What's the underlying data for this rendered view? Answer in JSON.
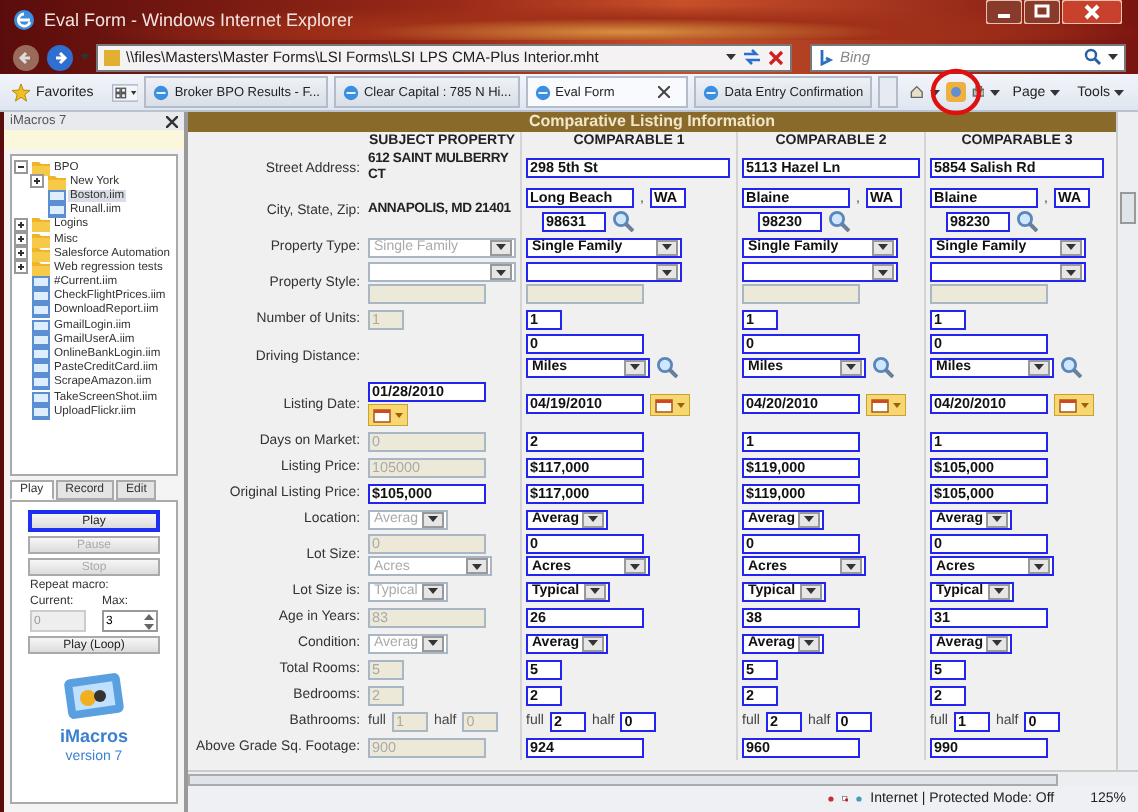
{
  "window": {
    "title": "Eval Form - Windows Internet Explorer"
  },
  "address_bar": {
    "url": "\\\\files\\Masters\\Master Forms\\LSI Forms\\LSI LPS CMA-Plus Interior.mht"
  },
  "search": {
    "placeholder": "Bing"
  },
  "favorites_bar": {
    "favorites_label": "Favorites",
    "tabs": [
      {
        "title": "Broker BPO Results - F...",
        "selected": false
      },
      {
        "title": "Clear Capital : 785 N Hi...",
        "selected": false
      },
      {
        "title": "Eval Form",
        "selected": true
      },
      {
        "title": "Data Entry Confirmation",
        "selected": false
      }
    ],
    "menus": [
      "Page",
      "Tools"
    ]
  },
  "sidebar": {
    "title": "iMacros 7",
    "tree": [
      {
        "label": "BPO",
        "kind": "folder",
        "expanded": true,
        "selected": false,
        "children": [
          {
            "label": "New York",
            "kind": "folder",
            "expanded": false,
            "selected": false
          },
          {
            "label": "Boston.iim",
            "kind": "file",
            "selected": true
          },
          {
            "label": "Runall.iim",
            "kind": "file",
            "selected": false
          }
        ]
      },
      {
        "label": "Logins",
        "kind": "folder",
        "expanded": false,
        "selected": false
      },
      {
        "label": "Misc",
        "kind": "folder",
        "expanded": false,
        "selected": false
      },
      {
        "label": "Salesforce Automation",
        "kind": "folder",
        "expanded": false,
        "selected": false
      },
      {
        "label": "Web regression tests",
        "kind": "folder",
        "expanded": false,
        "selected": false
      },
      {
        "label": "#Current.iim",
        "kind": "file",
        "selected": false
      },
      {
        "label": "CheckFlightPrices.iim",
        "kind": "file",
        "selected": false
      },
      {
        "label": "DownloadReport.iim",
        "kind": "file",
        "selected": false
      },
      {
        "label": "GmailLogin.iim",
        "kind": "file",
        "selected": false
      },
      {
        "label": "GmailUserA.iim",
        "kind": "file",
        "selected": false
      },
      {
        "label": "OnlineBankLogin.iim",
        "kind": "file",
        "selected": false
      },
      {
        "label": "PasteCreditCard.iim",
        "kind": "file",
        "selected": false
      },
      {
        "label": "ScrapeAmazon.iim",
        "kind": "file",
        "selected": false
      },
      {
        "label": "TakeScreenShot.iim",
        "kind": "file",
        "selected": false
      },
      {
        "label": "UploadFlickr.iim",
        "kind": "file",
        "selected": false
      }
    ],
    "tabs": [
      {
        "label": "Play",
        "selected": true
      },
      {
        "label": "Record",
        "selected": false
      },
      {
        "label": "Edit",
        "selected": false
      }
    ],
    "buttons": [
      {
        "label": "Play",
        "disabled": false,
        "focused": true
      },
      {
        "label": "Pause",
        "disabled": true,
        "focused": false
      },
      {
        "label": "Stop",
        "disabled": true,
        "focused": false
      }
    ],
    "repeat": {
      "label": "Repeat macro:",
      "current_label": "Current:",
      "max_label": "Max:",
      "current_value": "0",
      "max_value": "3"
    },
    "loop_button": "Play (Loop)",
    "logo": {
      "name": "iMacros",
      "version": "version 7"
    }
  },
  "form": {
    "banner": "Comparative Listing Information",
    "columns": [
      "SUBJECT PROPERTY",
      "COMPARABLE 1",
      "COMPARABLE 2",
      "COMPARABLE 3"
    ],
    "rows": [
      {
        "label": "Street Address:",
        "cells": [
          [
            {
              "kind": "text",
              "value": "612 SAINT MULBERRY CT"
            }
          ],
          [
            {
              "kind": "wide-input",
              "value": "298 5th St",
              "disabled": false
            }
          ],
          [
            {
              "kind": "wide-input",
              "value": "5113 Hazel Ln",
              "disabled": false
            }
          ],
          [
            {
              "kind": "wide-input",
              "value": "5854 Salish Rd",
              "disabled": false
            }
          ]
        ]
      },
      {
        "label": "City, State, Zip:",
        "cells": [
          [
            {
              "kind": "text",
              "value": "ANNAPOLIS, MD 21401"
            }
          ],
          [
            {
              "kind": "input",
              "value": "Long Beach",
              "disabled": false
            },
            {
              "kind": "label",
              "value": ","
            },
            {
              "kind": "small-input",
              "value": "WA",
              "disabled": false
            },
            {
              "kind": "zip-input",
              "value": "98631",
              "disabled": false
            },
            {
              "kind": "lookup"
            }
          ],
          [
            {
              "kind": "input",
              "value": "Blaine",
              "disabled": false
            },
            {
              "kind": "label",
              "value": ","
            },
            {
              "kind": "small-input",
              "value": "WA",
              "disabled": false
            },
            {
              "kind": "zip-input",
              "value": "98230",
              "disabled": false
            },
            {
              "kind": "lookup"
            }
          ],
          [
            {
              "kind": "input",
              "value": "Blaine",
              "disabled": false
            },
            {
              "kind": "label",
              "value": ","
            },
            {
              "kind": "small-input",
              "value": "WA",
              "disabled": false
            },
            {
              "kind": "zip-input",
              "value": "98230",
              "disabled": false
            },
            {
              "kind": "lookup"
            }
          ]
        ]
      },
      {
        "label": "Property Type:",
        "cells": [
          [
            {
              "kind": "select",
              "value": "Single Family",
              "disabled": true
            }
          ],
          [
            {
              "kind": "select",
              "value": "Single Family",
              "disabled": false
            }
          ],
          [
            {
              "kind": "select",
              "value": "Single Family",
              "disabled": false
            }
          ],
          [
            {
              "kind": "select",
              "value": "Single Family",
              "disabled": false
            }
          ]
        ]
      },
      {
        "label": "Property Style:",
        "cells": [
          [
            {
              "kind": "select",
              "disabled": true
            },
            {
              "kind": "input",
              "disabled": true
            }
          ],
          [
            {
              "kind": "select",
              "disabled": false
            },
            {
              "kind": "input",
              "disabled": true
            }
          ],
          [
            {
              "kind": "select",
              "disabled": false
            },
            {
              "kind": "input",
              "disabled": true
            }
          ],
          [
            {
              "kind": "select",
              "disabled": false
            },
            {
              "kind": "input",
              "disabled": true
            }
          ]
        ]
      },
      {
        "label": "Number of Units:",
        "cells": [
          [
            {
              "kind": "small-input",
              "value": "1",
              "disabled": true
            }
          ],
          [
            {
              "kind": "small-input",
              "value": "1",
              "disabled": false
            }
          ],
          [
            {
              "kind": "small-input",
              "value": "1",
              "disabled": false
            }
          ],
          [
            {
              "kind": "small-input",
              "value": "1",
              "disabled": false
            }
          ]
        ]
      },
      {
        "label": "Driving Distance:",
        "cells": [
          [],
          [
            {
              "kind": "input",
              "value": "0",
              "disabled": false
            },
            {
              "kind": "short-select",
              "value": "Miles",
              "disabled": false
            },
            {
              "kind": "lookup"
            }
          ],
          [
            {
              "kind": "input",
              "value": "0",
              "disabled": false
            },
            {
              "kind": "short-select",
              "value": "Miles",
              "disabled": false
            },
            {
              "kind": "lookup"
            }
          ],
          [
            {
              "kind": "input",
              "value": "0",
              "disabled": false
            },
            {
              "kind": "short-select",
              "value": "Miles",
              "disabled": false
            },
            {
              "kind": "lookup"
            }
          ]
        ]
      },
      {
        "label": "Listing Date:",
        "cells": [
          [
            {
              "kind": "input",
              "value": "01/28/2010",
              "disabled": false
            },
            {
              "kind": "calendar"
            }
          ],
          [
            {
              "kind": "input",
              "value": "04/19/2010",
              "disabled": false
            },
            {
              "kind": "calendar"
            }
          ],
          [
            {
              "kind": "input",
              "value": "04/20/2010",
              "disabled": false
            },
            {
              "kind": "calendar"
            }
          ],
          [
            {
              "kind": "input",
              "value": "04/20/2010",
              "disabled": false
            },
            {
              "kind": "calendar"
            }
          ]
        ]
      },
      {
        "label": "Days on Market:",
        "cells": [
          [
            {
              "kind": "input",
              "value": "0",
              "disabled": true
            }
          ],
          [
            {
              "kind": "input",
              "value": "2",
              "disabled": false
            }
          ],
          [
            {
              "kind": "input",
              "value": "1",
              "disabled": false
            }
          ],
          [
            {
              "kind": "input",
              "value": "1",
              "disabled": false
            }
          ]
        ]
      },
      {
        "label": "Listing Price:",
        "cells": [
          [
            {
              "kind": "input",
              "value": "105000",
              "disabled": true
            }
          ],
          [
            {
              "kind": "input",
              "value": "$117,000",
              "disabled": false
            }
          ],
          [
            {
              "kind": "input",
              "value": "$119,000",
              "disabled": false
            }
          ],
          [
            {
              "kind": "input",
              "value": "$105,000",
              "disabled": false
            }
          ]
        ]
      },
      {
        "label": "Original Listing Price:",
        "cells": [
          [
            {
              "kind": "input",
              "value": "$105,000",
              "disabled": false
            }
          ],
          [
            {
              "kind": "input",
              "value": "$117,000",
              "disabled": false
            }
          ],
          [
            {
              "kind": "input",
              "value": "$119,000",
              "disabled": false
            }
          ],
          [
            {
              "kind": "input",
              "value": "$105,000",
              "disabled": false
            }
          ]
        ]
      },
      {
        "label": "Location:",
        "cells": [
          [
            {
              "kind": "short-select",
              "value": "Averag",
              "disabled": true
            }
          ],
          [
            {
              "kind": "short-select",
              "value": "Averag",
              "disabled": false
            }
          ],
          [
            {
              "kind": "short-select",
              "value": "Averag",
              "disabled": false
            }
          ],
          [
            {
              "kind": "short-select",
              "value": "Averag",
              "disabled": false
            }
          ]
        ]
      },
      {
        "label": "Lot Size:",
        "cells": [
          [
            {
              "kind": "input",
              "value": "0",
              "disabled": true
            },
            {
              "kind": "short-select",
              "value": "Acres",
              "disabled": true
            }
          ],
          [
            {
              "kind": "input",
              "value": "0",
              "disabled": false
            },
            {
              "kind": "short-select",
              "value": "Acres",
              "disabled": false
            }
          ],
          [
            {
              "kind": "input",
              "value": "0",
              "disabled": false
            },
            {
              "kind": "short-select",
              "value": "Acres",
              "disabled": false
            }
          ],
          [
            {
              "kind": "input",
              "value": "0",
              "disabled": false
            },
            {
              "kind": "short-select",
              "value": "Acres",
              "disabled": false
            }
          ]
        ]
      },
      {
        "label": "Lot Size is:",
        "cells": [
          [
            {
              "kind": "short-select",
              "value": "Typical",
              "disabled": true
            }
          ],
          [
            {
              "kind": "short-select",
              "value": "Typical",
              "disabled": false
            }
          ],
          [
            {
              "kind": "short-select",
              "value": "Typical",
              "disabled": false
            }
          ],
          [
            {
              "kind": "short-select",
              "value": "Typical",
              "disabled": false
            }
          ]
        ]
      },
      {
        "label": "Age in Years:",
        "cells": [
          [
            {
              "kind": "input",
              "value": "83",
              "disabled": true
            }
          ],
          [
            {
              "kind": "input",
              "value": "26",
              "disabled": false
            }
          ],
          [
            {
              "kind": "input",
              "value": "38",
              "disabled": false
            }
          ],
          [
            {
              "kind": "input",
              "value": "31",
              "disabled": false
            }
          ]
        ]
      },
      {
        "label": "Condition:",
        "cells": [
          [
            {
              "kind": "short-select",
              "value": "Averag",
              "disabled": true
            }
          ],
          [
            {
              "kind": "short-select",
              "value": "Averag",
              "disabled": false
            }
          ],
          [
            {
              "kind": "short-select",
              "value": "Averag",
              "disabled": false
            }
          ],
          [
            {
              "kind": "short-select",
              "value": "Averag",
              "disabled": false
            }
          ]
        ]
      },
      {
        "label": "Total Rooms:",
        "cells": [
          [
            {
              "kind": "small-input",
              "value": "5",
              "disabled": true
            }
          ],
          [
            {
              "kind": "small-input",
              "value": "5",
              "disabled": false
            }
          ],
          [
            {
              "kind": "small-input",
              "value": "5",
              "disabled": false
            }
          ],
          [
            {
              "kind": "small-input",
              "value": "5",
              "disabled": false
            }
          ]
        ]
      },
      {
        "label": "Bedrooms:",
        "cells": [
          [
            {
              "kind": "small-input",
              "value": "2",
              "disabled": true
            }
          ],
          [
            {
              "kind": "small-input",
              "value": "2",
              "disabled": false
            }
          ],
          [
            {
              "kind": "small-input",
              "value": "2",
              "disabled": false
            }
          ],
          [
            {
              "kind": "small-input",
              "value": "2",
              "disabled": false
            }
          ]
        ]
      },
      {
        "label": "Bathrooms:",
        "cells": [
          [
            {
              "kind": "label",
              "value": "full"
            },
            {
              "kind": "small-input",
              "value": "1",
              "disabled": true
            },
            {
              "kind": "label",
              "value": "half"
            },
            {
              "kind": "small-input",
              "value": "0",
              "disabled": true
            }
          ],
          [
            {
              "kind": "label",
              "value": "full"
            },
            {
              "kind": "small-input",
              "value": "2",
              "disabled": false
            },
            {
              "kind": "label",
              "value": "half"
            },
            {
              "kind": "small-input",
              "value": "0",
              "disabled": false
            }
          ],
          [
            {
              "kind": "label",
              "value": "full"
            },
            {
              "kind": "small-input",
              "value": "2",
              "disabled": false
            },
            {
              "kind": "label",
              "value": "half"
            },
            {
              "kind": "small-input",
              "value": "0",
              "disabled": false
            }
          ],
          [
            {
              "kind": "label",
              "value": "full"
            },
            {
              "kind": "small-input",
              "value": "1",
              "disabled": false
            },
            {
              "kind": "label",
              "value": "half"
            },
            {
              "kind": "small-input",
              "value": "0",
              "disabled": false
            }
          ]
        ]
      },
      {
        "label": "Above Grade Sq. Footage:",
        "cells": [
          [
            {
              "kind": "input",
              "value": "900",
              "disabled": true
            }
          ],
          [
            {
              "kind": "input",
              "value": "924",
              "disabled": false
            }
          ],
          [
            {
              "kind": "input",
              "value": "960",
              "disabled": false
            }
          ],
          [
            {
              "kind": "input",
              "value": "990",
              "disabled": false
            }
          ]
        ]
      }
    ]
  },
  "status_bar": {
    "zone": "Internet | Protected Mode: Off",
    "zoom": "125%"
  }
}
